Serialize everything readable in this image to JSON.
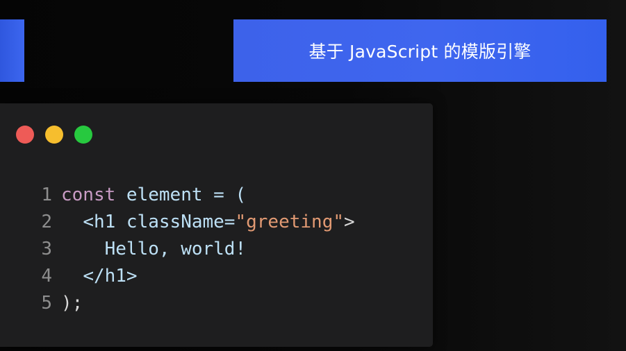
{
  "banner": {
    "title": "基于 JavaScript 的模版引擎"
  },
  "window": {
    "traffic_lights": [
      {
        "name": "close",
        "color": "#ee5b57"
      },
      {
        "name": "minimize",
        "color": "#f6be2e"
      },
      {
        "name": "maximize",
        "color": "#27c93f"
      }
    ]
  },
  "code": {
    "lines": [
      {
        "num": "1",
        "indent": "",
        "tokens": [
          {
            "t": "const",
            "c": "kw"
          },
          {
            "t": " element = (",
            "c": "id"
          }
        ]
      },
      {
        "num": "2",
        "indent": "  ",
        "tokens": [
          {
            "t": "<h1 className=",
            "c": "id"
          },
          {
            "t": "\"greeting\"",
            "c": "str"
          },
          {
            "t": ">",
            "c": "punc"
          }
        ]
      },
      {
        "num": "3",
        "indent": "    ",
        "tokens": [
          {
            "t": "Hello, world!",
            "c": "id"
          }
        ]
      },
      {
        "num": "4",
        "indent": "  ",
        "tokens": [
          {
            "t": "</h1>",
            "c": "id"
          }
        ]
      },
      {
        "num": "5",
        "indent": "",
        "tokens": [
          {
            "t": ");",
            "c": "punc"
          }
        ]
      }
    ]
  }
}
